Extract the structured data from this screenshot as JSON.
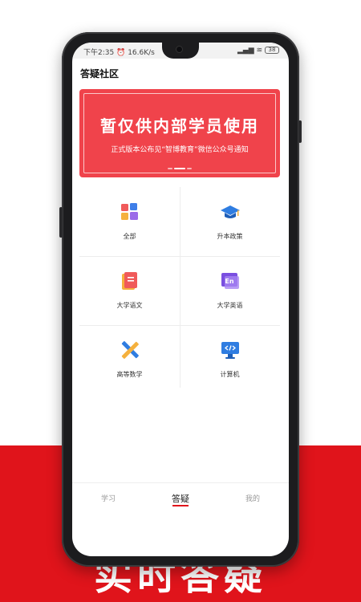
{
  "colors": {
    "brand_red": "#e0141b",
    "banner_red": "#f0434b"
  },
  "status_bar": {
    "time_text": "下午2:35",
    "speed_text": "16.6K/s",
    "battery_text": "38"
  },
  "header": {
    "title": "答疑社区"
  },
  "banner": {
    "title": "暂仅供内部学员使用",
    "subtitle": "正式版本公布见“智博教育”微信公众号通知"
  },
  "categories": [
    {
      "label": "全部",
      "icon": "apps-icon"
    },
    {
      "label": "升本政策",
      "icon": "graduation-cap-icon"
    },
    {
      "label": "大学语文",
      "icon": "notebook-icon"
    },
    {
      "label": "大学英语",
      "icon": "english-icon"
    },
    {
      "label": "高等数学",
      "icon": "ruler-pencil-icon"
    },
    {
      "label": "计算机",
      "icon": "code-monitor-icon"
    }
  ],
  "tabbar": {
    "tabs": [
      {
        "label": "学习"
      },
      {
        "label": "答疑"
      },
      {
        "label": "我的"
      }
    ],
    "active_index": 1
  },
  "slogan": "实时答疑"
}
